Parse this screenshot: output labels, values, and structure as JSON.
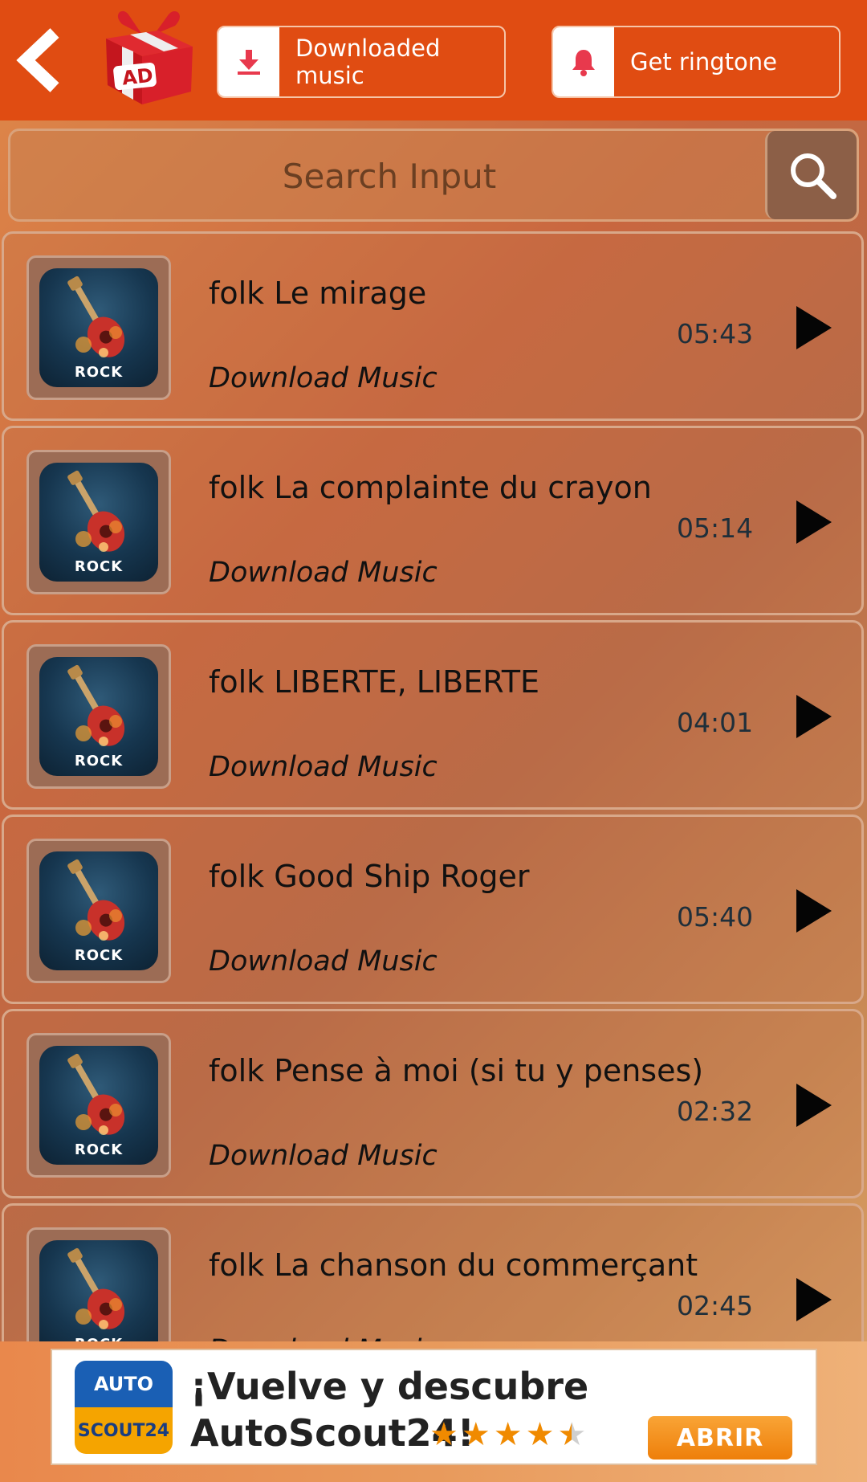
{
  "header": {
    "back_icon": "chevron-left-icon",
    "ad_gift_label": "AD",
    "downloaded_button": {
      "label": "Downloaded music",
      "icon": "download-icon"
    },
    "ringtone_button": {
      "label": "Get ringtone",
      "icon": "bell-icon"
    }
  },
  "search": {
    "placeholder": "Search Input",
    "icon": "search-icon"
  },
  "tracks": [
    {
      "title": "folk Le mirage",
      "subtitle": "Download Music",
      "duration": "05:43",
      "thumb_label": "ROCK"
    },
    {
      "title": "folk La complainte du crayon",
      "subtitle": "Download Music",
      "duration": "05:14",
      "thumb_label": "ROCK"
    },
    {
      "title": "folk LIBERTE, LIBERTE",
      "subtitle": "Download Music",
      "duration": "04:01",
      "thumb_label": "ROCK"
    },
    {
      "title": "folk Good Ship Roger",
      "subtitle": "Download Music",
      "duration": "05:40",
      "thumb_label": "ROCK"
    },
    {
      "title": "folk Pense à moi (si tu y penses)",
      "subtitle": "Download Music",
      "duration": "02:32",
      "thumb_label": "ROCK"
    },
    {
      "title": "folk La chanson du commerçant",
      "subtitle": "Download Music",
      "duration": "02:45",
      "thumb_label": "ROCK"
    }
  ],
  "ad": {
    "logo_top": "AUTO",
    "logo_bottom": "SCOUT24",
    "line1": "¡Vuelve y descubre",
    "line2": "AutoScout24!",
    "rating": 4.5,
    "cta": "ABRIR"
  },
  "colors": {
    "topbar": "#e04c12",
    "accent_icon": "#e8394d",
    "ad_cta": "#ee7f0a"
  }
}
